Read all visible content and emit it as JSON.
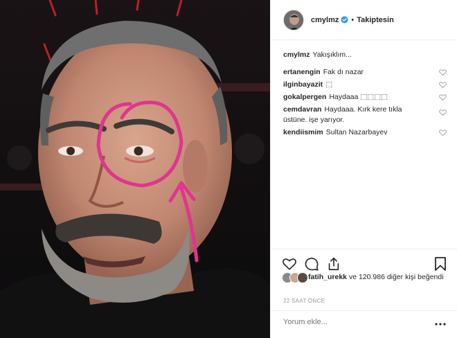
{
  "header": {
    "username": "cmylmz",
    "separator": "•",
    "follow_label": "Takiptesin"
  },
  "caption": {
    "username": "cmylmz",
    "text": "Yakışıklım..."
  },
  "comments": [
    {
      "username": "ertanengin",
      "text": "Fak dı nazar"
    },
    {
      "username": "ilginbayazit",
      "text": "⬚"
    },
    {
      "username": "gokalpergen",
      "text": "Haydaaa ⬚⬚⬚⬚"
    },
    {
      "username": "cemdavran",
      "text": "Haydaaa. Kırk kere tıkla üstüne. işe yarıyor."
    },
    {
      "username": "kendiismim",
      "text": "Sultan Nazarbayev"
    }
  ],
  "likes": {
    "first_user": "fatih_urekk",
    "rest": "ve 120.986 diğer kişi beğendi"
  },
  "time": "22 SAAT ÖNCE",
  "add_comment": {
    "placeholder": "Yorum ekle..."
  },
  "icons": {
    "verified": "verified-badge-icon",
    "like": "heart-icon",
    "comment": "comment-bubble-icon",
    "share": "share-icon",
    "save": "bookmark-icon",
    "more": "more-dots-icon"
  },
  "colors": {
    "verified": "#3897f0",
    "annotation": "#e0358f",
    "divider": "#efefef"
  }
}
